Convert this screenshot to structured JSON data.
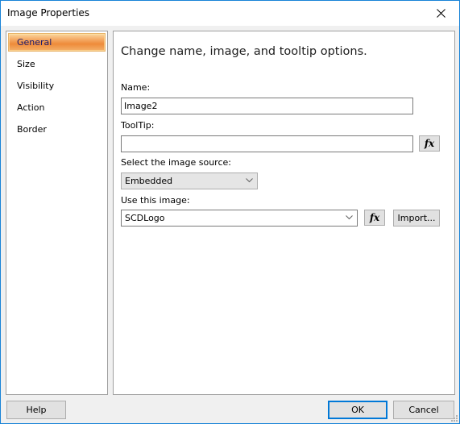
{
  "window": {
    "title": "Image Properties",
    "close_icon": "close-icon"
  },
  "sidebar": {
    "items": [
      {
        "label": "General",
        "selected": true
      },
      {
        "label": "Size",
        "selected": false
      },
      {
        "label": "Visibility",
        "selected": false
      },
      {
        "label": "Action",
        "selected": false
      },
      {
        "label": "Border",
        "selected": false
      }
    ],
    "selected_color": "#ee8b3a"
  },
  "content": {
    "heading": "Change name, image, and tooltip options.",
    "name": {
      "label": "Name:",
      "value": "Image2"
    },
    "tooltip": {
      "label": "ToolTip:",
      "value": "",
      "fx_label": "fx"
    },
    "image_source": {
      "label": "Select the image source:",
      "selected": "Embedded"
    },
    "use_image": {
      "label": "Use this image:",
      "selected": "SCDLogo",
      "fx_label": "fx",
      "import_label": "Import..."
    }
  },
  "footer": {
    "help_label": "Help",
    "ok_label": "OK",
    "cancel_label": "Cancel"
  },
  "colors": {
    "accent": "#0078d7",
    "window_border": "#1883d7"
  }
}
